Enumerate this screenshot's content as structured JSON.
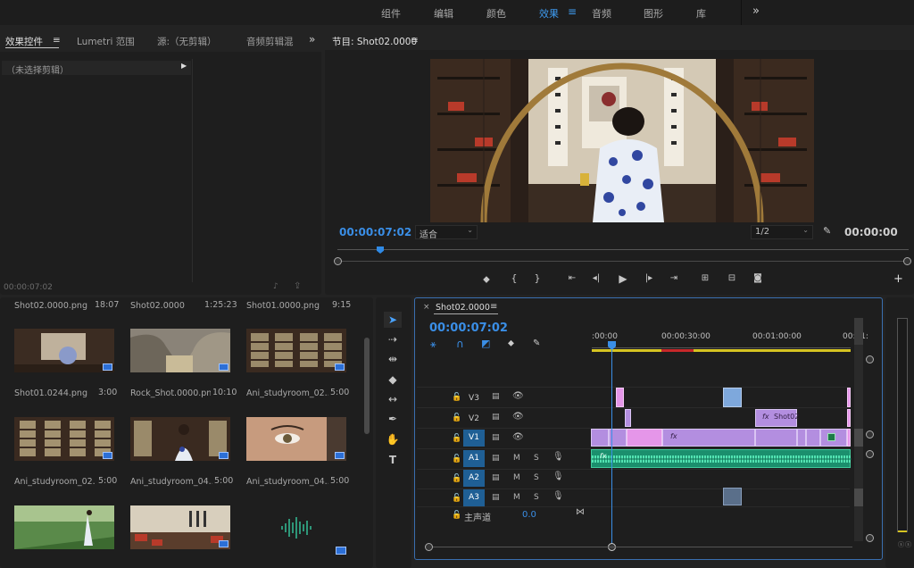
{
  "workspace_tabs": [
    {
      "label": "组件",
      "active": false
    },
    {
      "label": "编辑",
      "active": false
    },
    {
      "label": "颜色",
      "active": false
    },
    {
      "label": "效果",
      "active": true
    },
    {
      "label": "音频",
      "active": false
    },
    {
      "label": "图形",
      "active": false
    },
    {
      "label": "库",
      "active": false
    }
  ],
  "workspace_menu_icon": "≡",
  "workspace_more": "»",
  "effect_panel": {
    "tabs": [
      {
        "label": "效果控件",
        "active": true
      },
      {
        "label": "Lumetri 范围",
        "active": false
      },
      {
        "label": "源:（无剪辑）",
        "active": false
      },
      {
        "label": "音频剪辑混",
        "active": false
      }
    ],
    "menu_icon": "≡",
    "more": "»",
    "no_clip": "（未选择剪辑）",
    "expand_arrow": "▶",
    "timecode": "00:00:07:02"
  },
  "program_monitor": {
    "title": "节目: Shot02.0000",
    "menu_icon": "≡",
    "timecode": "00:00:07:02",
    "fit": "适合",
    "resolution": "1/2",
    "duration": "00:00:00",
    "wrench": "🔧",
    "add": "+"
  },
  "project_panel": {
    "items": [
      {
        "name": "Shot02.0000.png",
        "duration": "18:07"
      },
      {
        "name": "Shot02.0000",
        "duration": "1:25:23"
      },
      {
        "name": "Shot01.0000.png",
        "duration": "9:15"
      },
      {
        "name": "Shot01.0244.png",
        "duration": "3:00"
      },
      {
        "name": "Rock_Shot.0000.png",
        "duration": "10:10"
      },
      {
        "name": "Ani_studyroom_02...",
        "duration": "5:00"
      },
      {
        "name": "Ani_studyroom_02...",
        "duration": "5:00"
      },
      {
        "name": "Ani_studyroom_04...",
        "duration": "5:00"
      },
      {
        "name": "Ani_studyroom_04...",
        "duration": "5:00"
      }
    ]
  },
  "tools": [
    "pointer",
    "track-select",
    "ripple",
    "razor",
    "slip",
    "pen",
    "hand",
    "type"
  ],
  "timeline": {
    "close": "×",
    "sequence": "Shot02.0000",
    "menu_icon": "≡",
    "timecode": "00:00:07:02",
    "ruler": [
      ":00:00",
      "00:00:30:00",
      "00:01:00:00",
      "00:01:"
    ],
    "tracks": [
      {
        "label": "V3",
        "target": false,
        "kind": "video"
      },
      {
        "label": "V2",
        "target": false,
        "kind": "video"
      },
      {
        "label": "V1",
        "target": true,
        "kind": "video"
      },
      {
        "label": "A1",
        "target": true,
        "kind": "audio"
      },
      {
        "label": "A2",
        "target": true,
        "kind": "audio"
      },
      {
        "label": "A3",
        "target": true,
        "kind": "audio"
      }
    ],
    "mute": "M",
    "solo": "S",
    "master_label": "主声道",
    "master_value": "0.0",
    "fx_label": "fx",
    "v2_clip_name": "Shot02"
  },
  "colors": {
    "accent": "#3e9bf0",
    "target_track": "#1f5f95",
    "video_clip": "#b38ee0",
    "audio_clip": "#1b8f6d"
  }
}
